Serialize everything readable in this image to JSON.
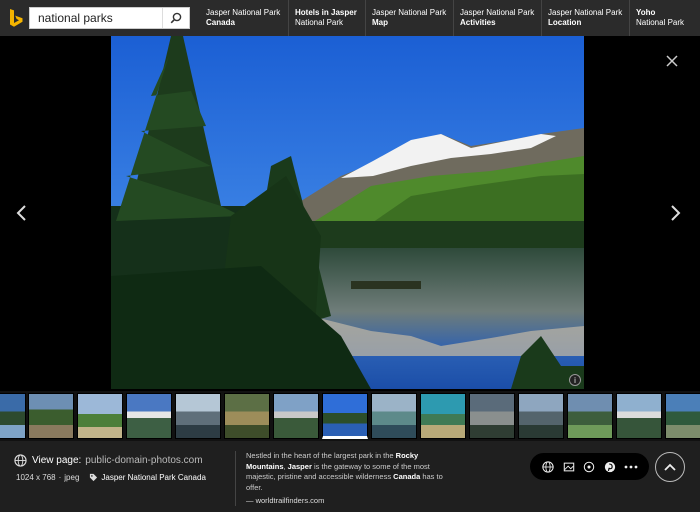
{
  "search": {
    "query": "national parks"
  },
  "related": [
    {
      "line1": "Jasper National Park",
      "line2": "Canada"
    },
    {
      "line1": "Hotels in Jasper",
      "line2": "National Park"
    },
    {
      "line1": "Jasper National Park",
      "line2": "Map"
    },
    {
      "line1": "Jasper National Park",
      "line2": "Activities"
    },
    {
      "line1": "Jasper National Park",
      "line2": "Location"
    },
    {
      "line1": "Yoho",
      "line2": "National Park"
    }
  ],
  "info_badge": "i",
  "details": {
    "view_page_label": "View page:",
    "domain": "public-domain-photos.com",
    "dimensions": "1024 x 768",
    "sep": "·",
    "format": "jpeg",
    "tag": "Jasper National Park Canada",
    "desc_parts": [
      {
        "text": "Nestled in the heart of the largest park in the ",
        "bold": false
      },
      {
        "text": "Rocky Mountains",
        "bold": true
      },
      {
        "text": ", ",
        "bold": false
      },
      {
        "text": "Jasper",
        "bold": true
      },
      {
        "text": " is the gateway to some of the most majestic, pristine and accessible wilderness ",
        "bold": false
      },
      {
        "text": "Canada",
        "bold": true
      },
      {
        "text": " has to offer.",
        "bold": false
      }
    ],
    "source": "— worldtrailfinders.com"
  },
  "icons": {
    "logo": "bing-logo-icon",
    "search": "search-icon",
    "prev": "chevron-left-icon",
    "next": "chevron-right-icon",
    "close": "close-icon",
    "globe": "globe-icon",
    "tag": "tag-icon",
    "actions": [
      "globe-icon",
      "image-icon",
      "visual-search-icon",
      "pinterest-icon",
      "more-icon"
    ],
    "up": "chevron-up-icon"
  },
  "colors": {
    "topbar": "#2b2b2b",
    "bottom": "#1f1f1f",
    "bing_yellow": "#f4b400"
  }
}
